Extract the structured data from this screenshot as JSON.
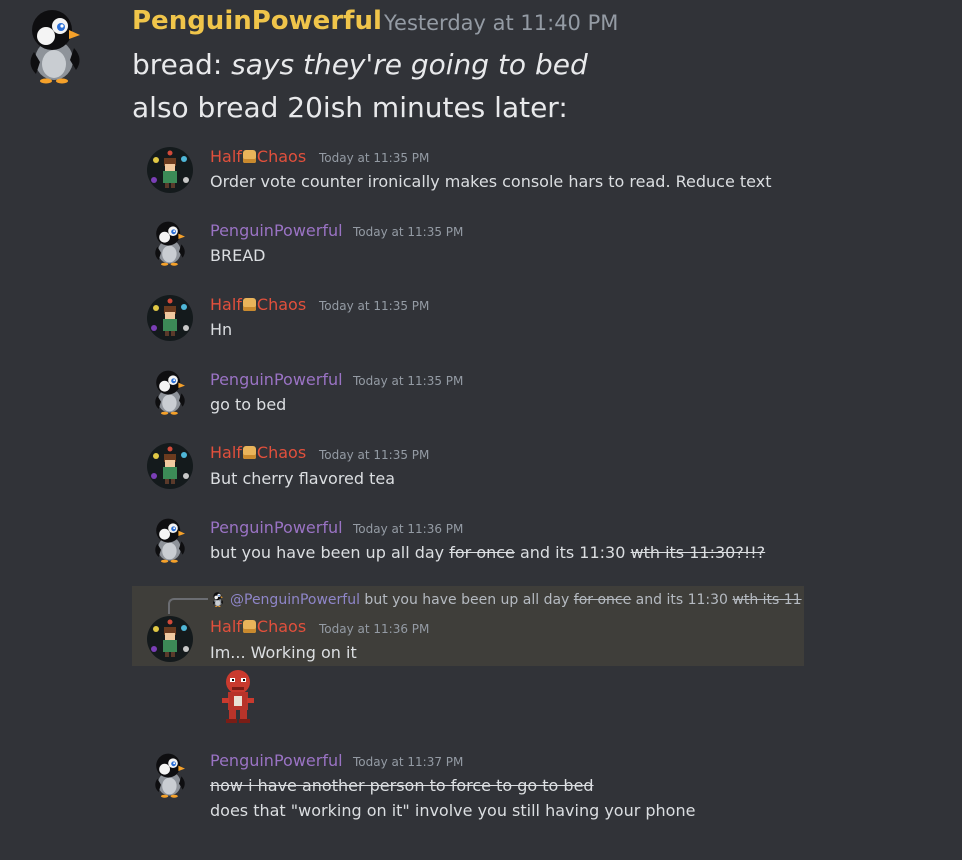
{
  "header": {
    "author": "PenguinPowerful",
    "timestamp": "Yesterday at 11:40 PM",
    "line1_prefix": "bread: ",
    "line1_italic": "says they're going to bed",
    "line2": "also bread 20ish minutes later:"
  },
  "messages": [
    {
      "author_pre": "Half",
      "author_post": "Chaos",
      "time": "Today at 11:35 PM",
      "text": "Order vote counter ironically makes console hars to read. Reduce text"
    },
    {
      "author": "PenguinPowerful",
      "time": "Today at 11:35 PM",
      "text": "BREAD"
    },
    {
      "author_pre": "Half",
      "author_post": "Chaos",
      "time": "Today at 11:35 PM",
      "text": "Hn"
    },
    {
      "author": "PenguinPowerful",
      "time": "Today at 11:35 PM",
      "text": "go to bed"
    },
    {
      "author_pre": "Half",
      "author_post": "Chaos",
      "time": "Today at 11:35 PM",
      "text": "But cherry flavored tea"
    },
    {
      "author": "PenguinPowerful",
      "time": "Today at 11:36 PM",
      "text_a": "but you have been up all day ",
      "strike_a": "for once",
      "text_b": " and its 11:30 ",
      "strike_b": "wth its 11:30?!!?"
    },
    {
      "author_pre": "Half",
      "author_post": "Chaos",
      "time": "Today at 11:36 PM",
      "text": "Im... Working on it",
      "reply": {
        "mention": "@PenguinPowerful",
        "text_a": " but you have been up all day ",
        "strike_a": "for once",
        "text_b": " and its 11:30 ",
        "strike_b": "wth its 11"
      }
    },
    {
      "author": "PenguinPowerful",
      "time": "Today at 11:37 PM",
      "strike_line": "now i have another person to force to go to bed",
      "text": "does that \"working on it\" involve you still having your phone"
    }
  ]
}
